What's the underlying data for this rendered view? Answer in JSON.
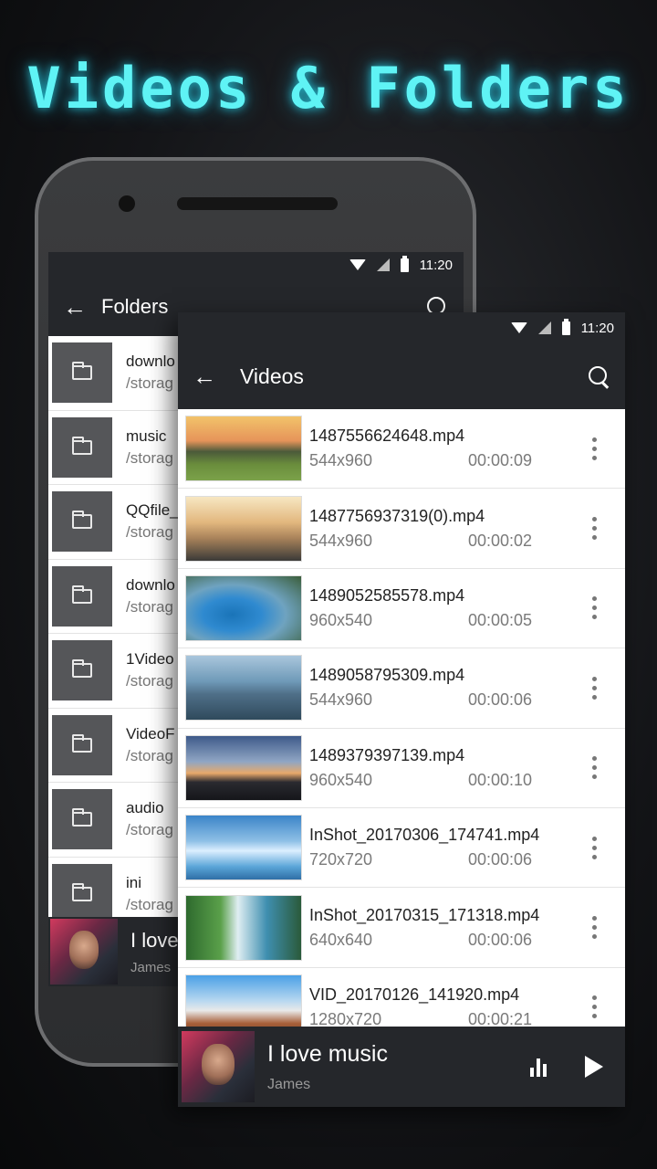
{
  "headline": "Videos & Folders",
  "status": {
    "time": "11:20"
  },
  "folders_screen": {
    "title": "Folders",
    "items": [
      {
        "name": "downlo",
        "path": "/storag"
      },
      {
        "name": "music",
        "path": "/storag"
      },
      {
        "name": "QQfile_",
        "path": "/storag"
      },
      {
        "name": "downlo",
        "path": "/storag"
      },
      {
        "name": "1Video",
        "path": "/storag"
      },
      {
        "name": "VideoF",
        "path": "/storag"
      },
      {
        "name": "audio",
        "path": "/storag"
      },
      {
        "name": "ini",
        "path": "/storag"
      }
    ],
    "player": {
      "title": "I love",
      "artist": "James"
    }
  },
  "videos_screen": {
    "title": "Videos",
    "items": [
      {
        "name": "1487556624648.mp4",
        "resolution": "544x960",
        "duration": "00:00:09"
      },
      {
        "name": "1487756937319(0).mp4",
        "resolution": "544x960",
        "duration": "00:00:02"
      },
      {
        "name": "1489052585578.mp4",
        "resolution": "960x540",
        "duration": "00:00:05"
      },
      {
        "name": "1489058795309.mp4",
        "resolution": "544x960",
        "duration": "00:00:06"
      },
      {
        "name": "1489379397139.mp4",
        "resolution": "960x540",
        "duration": "00:00:10"
      },
      {
        "name": "InShot_20170306_174741.mp4",
        "resolution": "720x720",
        "duration": "00:00:06"
      },
      {
        "name": "InShot_20170315_171318.mp4",
        "resolution": "640x640",
        "duration": "00:00:06"
      },
      {
        "name": "VID_20170126_141920.mp4",
        "resolution": "1280x720",
        "duration": "00:00:21"
      }
    ],
    "player": {
      "title": "I love music",
      "artist": "James"
    }
  },
  "colors": {
    "accent": "#5ff3f5",
    "appbar": "#25272b"
  },
  "icons": [
    "back-arrow-icon",
    "search-icon",
    "folder-icon",
    "more-vert-icon",
    "equalizer-icon",
    "play-icon",
    "wifi-icon",
    "signal-icon",
    "battery-icon"
  ]
}
